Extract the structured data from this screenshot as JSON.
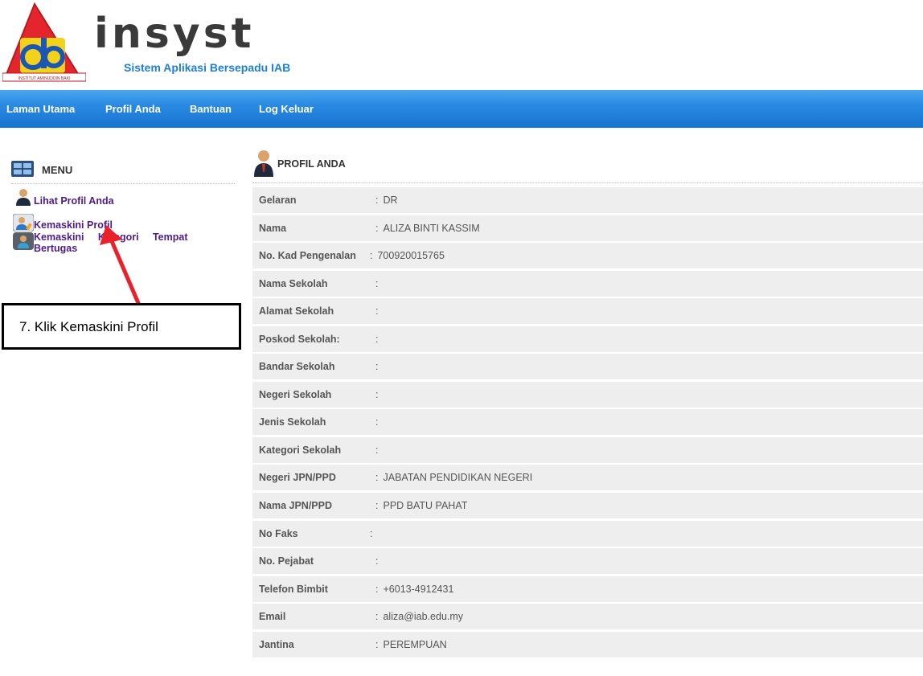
{
  "brand": {
    "name": "insyst",
    "tagline": "Sistem Aplikasi Bersepadu IAB",
    "logo_text": "INSTITUT AMINUDDIN BAKI"
  },
  "nav": {
    "items": [
      "Laman Utama",
      "Profil Anda",
      "Bantuan",
      "Log Keluar"
    ]
  },
  "sidebar": {
    "title": "MENU",
    "items": [
      {
        "label": "Lihat Profil Anda",
        "icon": "person-icon"
      },
      {
        "label": "Kemaskini Profil",
        "icon": "edit-profile-icon"
      },
      {
        "label_line1": "Kemaskini     Kategori     Tempat",
        "label_line2": "Bertugas",
        "icon": "workplace-icon"
      }
    ]
  },
  "annotation": {
    "text": "7. Klik Kemaskini Profil"
  },
  "profile": {
    "title": "PROFIL ANDA",
    "rows": [
      {
        "label": "Gelaran",
        "value": "DR"
      },
      {
        "label": "Nama",
        "value": "ALIZA BINTI KASSIM"
      },
      {
        "label": "No. Kad Pengenalan",
        "value": "700920015765"
      },
      {
        "label": "Nama Sekolah",
        "value": ""
      },
      {
        "label": "Alamat Sekolah",
        "value": ""
      },
      {
        "label": "Poskod Sekolah:",
        "value": ""
      },
      {
        "label": "Bandar Sekolah",
        "value": ""
      },
      {
        "label": "Negeri Sekolah",
        "value": ""
      },
      {
        "label": "Jenis Sekolah",
        "value": ""
      },
      {
        "label": "Kategori Sekolah",
        "value": ""
      },
      {
        "label": "Negeri JPN/PPD",
        "value": "JABATAN PENDIDIKAN NEGERI"
      },
      {
        "label": "Nama JPN/PPD",
        "value": "PPD BATU PAHAT"
      },
      {
        "label": "No Faks",
        "value": ""
      },
      {
        "label": "No. Pejabat",
        "value": ""
      },
      {
        "label": "Telefon Bimbit",
        "value": "+6013-4912431"
      },
      {
        "label": "Email",
        "value": "aliza@iab.edu.my"
      },
      {
        "label": "Jantina",
        "value": "PEREMPUAN"
      }
    ]
  },
  "colors": {
    "nav_top": "#4aa7ee",
    "nav_bottom": "#1673cf",
    "link": "#4e1b8a",
    "tagline": "#1e7fd6",
    "row_bg": "#eeeeee",
    "arrow": "#e8212a"
  }
}
